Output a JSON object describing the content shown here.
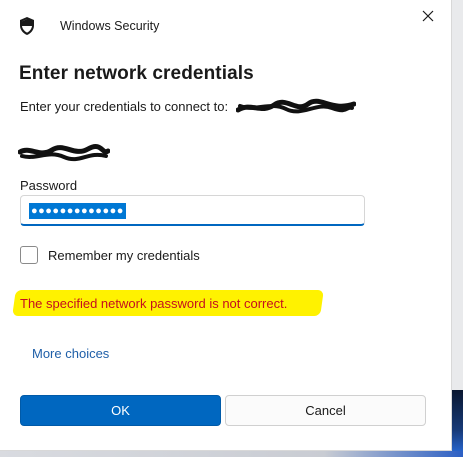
{
  "window": {
    "app_title": "Windows Security",
    "close_icon": "close-icon",
    "shield_icon": "shield-icon"
  },
  "dialog": {
    "heading": "Enter network credentials",
    "description": "Enter your credentials to connect to:",
    "password_label": "Password",
    "password_masked": "●●●●●●●●●●●●●",
    "remember_label": "Remember my credentials",
    "remember_checked": false,
    "error_message": "The specified network password is not correct.",
    "more_choices": "More choices",
    "ok_label": "OK",
    "cancel_label": "Cancel"
  },
  "colors": {
    "accent": "#0067c0",
    "error": "#c50f1f",
    "highlight": "#fff200",
    "link": "#1f5fa8"
  }
}
